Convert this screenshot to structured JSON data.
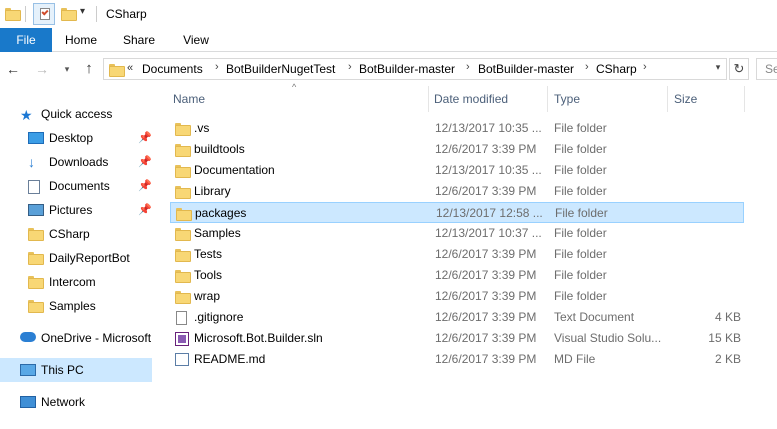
{
  "window": {
    "title": "CSharp"
  },
  "ribbon": {
    "tabs": [
      "File",
      "Home",
      "Share",
      "View"
    ]
  },
  "address": {
    "overflow": "«",
    "crumbs": [
      "Documents",
      "BotBuilderNugetTest",
      "BotBuilder-master",
      "BotBuilder-master",
      "CSharp"
    ],
    "search_placeholder": "Se"
  },
  "sidebar": {
    "quick_access": "Quick access",
    "pinned": [
      "Desktop",
      "Downloads",
      "Documents",
      "Pictures"
    ],
    "folders": [
      "CSharp",
      "DailyReportBot",
      "Intercom",
      "Samples"
    ],
    "onedrive": "OneDrive - Microsoft",
    "this_pc": "This PC",
    "network": "Network"
  },
  "columns": {
    "name": "Name",
    "date": "Date modified",
    "type": "Type",
    "size": "Size"
  },
  "files": [
    {
      "name": ".vs",
      "date": "12/13/2017 10:35 ...",
      "type": "File folder",
      "size": "",
      "icon": "folder-icon"
    },
    {
      "name": "buildtools",
      "date": "12/6/2017 3:39 PM",
      "type": "File folder",
      "size": "",
      "icon": "folder-icon"
    },
    {
      "name": "Documentation",
      "date": "12/13/2017 10:35 ...",
      "type": "File folder",
      "size": "",
      "icon": "folder-icon"
    },
    {
      "name": "Library",
      "date": "12/6/2017 3:39 PM",
      "type": "File folder",
      "size": "",
      "icon": "folder-icon"
    },
    {
      "name": "packages",
      "date": "12/13/2017 12:58 ...",
      "type": "File folder",
      "size": "",
      "icon": "folder-icon",
      "selected": true
    },
    {
      "name": "Samples",
      "date": "12/13/2017 10:37 ...",
      "type": "File folder",
      "size": "",
      "icon": "folder-icon"
    },
    {
      "name": "Tests",
      "date": "12/6/2017 3:39 PM",
      "type": "File folder",
      "size": "",
      "icon": "folder-icon"
    },
    {
      "name": "Tools",
      "date": "12/6/2017 3:39 PM",
      "type": "File folder",
      "size": "",
      "icon": "folder-icon"
    },
    {
      "name": "wrap",
      "date": "12/6/2017 3:39 PM",
      "type": "File folder",
      "size": "",
      "icon": "folder-icon"
    },
    {
      "name": ".gitignore",
      "date": "12/6/2017 3:39 PM",
      "type": "Text Document",
      "size": "4 KB",
      "icon": "text-file-icon"
    },
    {
      "name": "Microsoft.Bot.Builder.sln",
      "date": "12/6/2017 3:39 PM",
      "type": "Visual Studio Solu...",
      "size": "15 KB",
      "icon": "solution-file-icon"
    },
    {
      "name": "README.md",
      "date": "12/6/2017 3:39 PM",
      "type": "MD File",
      "size": "2 KB",
      "icon": "markdown-file-icon"
    }
  ],
  "colors": {
    "accent": "#1979ca",
    "selection": "#cce8ff",
    "selection_border": "#99d1ff",
    "folder": "#f8d775"
  }
}
